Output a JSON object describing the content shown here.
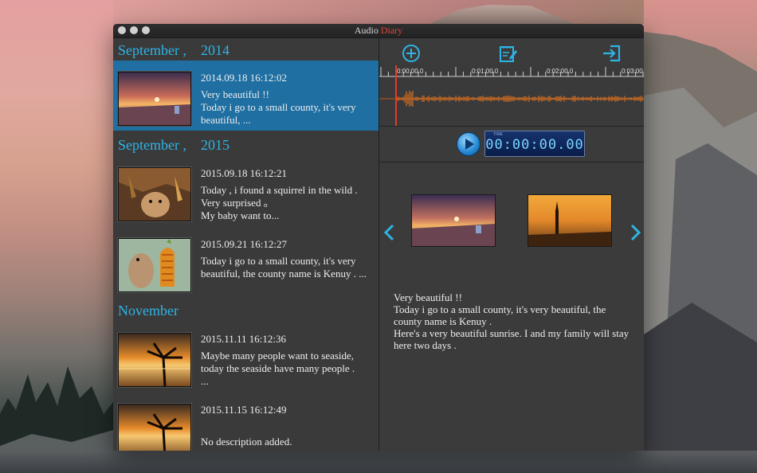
{
  "window": {
    "title_prefix": "Audio ",
    "title_suffix": "Diary"
  },
  "list": {
    "sections": [
      {
        "label": "September ,    2014"
      },
      {
        "label": "September ,    2015"
      },
      {
        "label": "November"
      }
    ],
    "entries": [
      {
        "date": "2014.09.18 16:12:02",
        "desc": "Very beautiful !!\nToday i go to a small county, it's very beautiful, ...",
        "thumb": "sunset-beach"
      },
      {
        "date": "2015.09.18 16:12:21",
        "desc": "Today , i found a squirrel in the wild . Very surprised 。\nMy baby want to...",
        "thumb": "squirrel"
      },
      {
        "date": "2015.09.21 16:12:27",
        "desc": "Today i go to a small county, it's very beautiful, the county name is Kenuy . ...",
        "thumb": "chipmunk-corn"
      },
      {
        "date": "2015.11.11 16:12:36",
        "desc": "Maybe many people want to seaside, today the seaside have many people .\n...",
        "thumb": "palm-sunset"
      },
      {
        "date": "2015.11.15 16:12:49",
        "desc": "No description added.",
        "thumb": "palm-sunset"
      }
    ]
  },
  "toolbar": {
    "add_icon": "plus-circle-icon",
    "edit_icon": "edit-note-icon",
    "export_icon": "export-icon"
  },
  "timeline": {
    "labels": [
      "0:00:00.0",
      "0:01:00.0",
      "0:02:00.0",
      "0:03:00"
    ]
  },
  "player": {
    "time_label": "TIME",
    "time_value": "00:00:00.00"
  },
  "detail": {
    "text": "Very beautiful !!\nToday i go to a small county, it's very beautiful,  the county name is Kenuy .\nHere's a very beautiful sunrise.  I  and my family will stay here  two days ."
  },
  "colors": {
    "accent": "#2eb4e6",
    "selected": "#1f6fa2",
    "playhead": "#e23a2a",
    "waveform": "#f07a1e"
  }
}
